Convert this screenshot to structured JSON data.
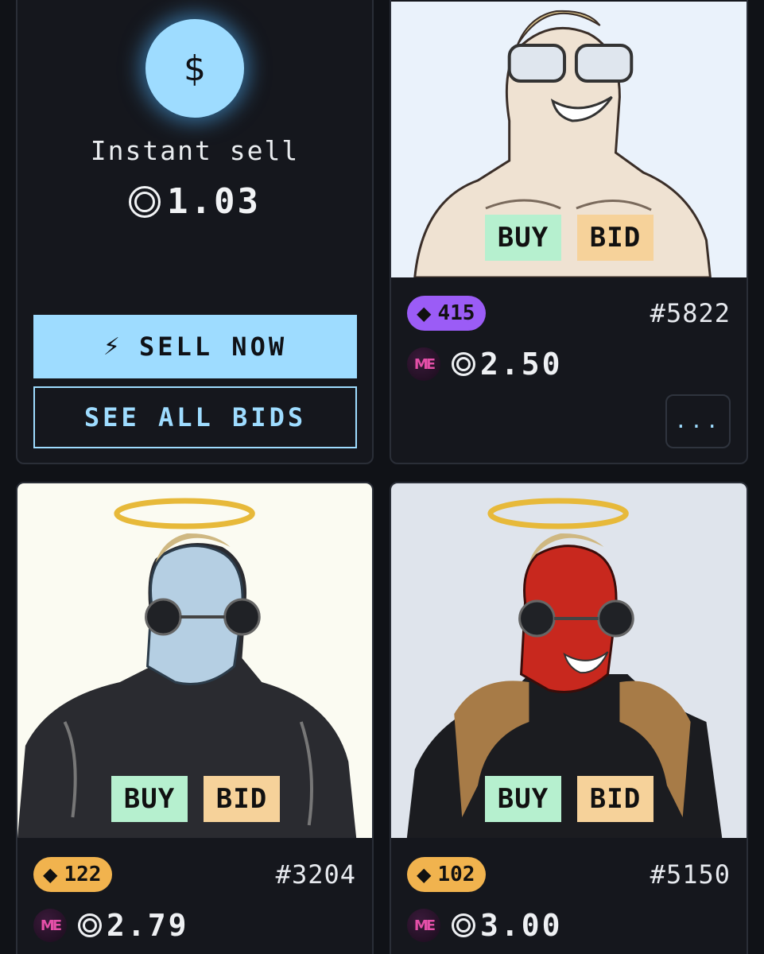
{
  "sell_card": {
    "icon": "dollar-sign",
    "dollar": "$",
    "label": "Instant sell",
    "price": "1.03",
    "sell_button": "SELL NOW",
    "sell_icon": "lightning-bolt",
    "bolt": "⚡",
    "bids_button": "SEE ALL BIDS"
  },
  "nfts": [
    {
      "rank": "415",
      "rank_color": "#9b5cf6",
      "id": "#5822",
      "price": "2.50",
      "buy": "BUY",
      "bid": "BID",
      "more": "..."
    },
    {
      "rank": "122",
      "rank_color": "#f1b34e",
      "id": "#3204",
      "price": "2.79",
      "buy": "BUY",
      "bid": "BID"
    },
    {
      "rank": "102",
      "rank_color": "#f1b34e",
      "id": "#5150",
      "price": "3.00",
      "buy": "BUY",
      "bid": "BID"
    }
  ],
  "marketplace_logo": "ME",
  "gem_glyph": "◆",
  "colors": {
    "accent": "#9edcff",
    "buy": "#b6f0cf",
    "bid": "#f6d29a",
    "background": "#101217"
  }
}
